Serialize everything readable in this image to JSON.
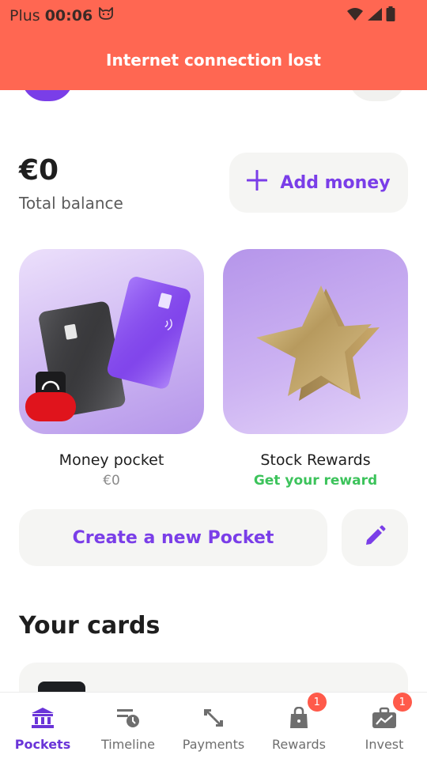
{
  "status_bar": {
    "carrier": "Plus",
    "time": "00:06"
  },
  "banner": {
    "message": "Internet connection lost",
    "color": "#ff6752"
  },
  "balance": {
    "amount": "€0",
    "label": "Total balance"
  },
  "actions": {
    "add_money_label": "Add money",
    "create_pocket_label": "Create a new Pocket"
  },
  "pockets": [
    {
      "name": "Money pocket",
      "subtitle": "€0",
      "subtitle_color": "#8a8a8a"
    },
    {
      "name": "Stock Rewards",
      "subtitle": "Get your reward",
      "subtitle_color": "#3cc35b"
    }
  ],
  "cards_section": {
    "title": "Your cards"
  },
  "bottom_nav": {
    "items": [
      {
        "label": "Pockets",
        "icon": "bank-icon",
        "active": true
      },
      {
        "label": "Timeline",
        "icon": "timeline-icon",
        "active": false
      },
      {
        "label": "Payments",
        "icon": "transfer-arrows-icon",
        "active": false
      },
      {
        "label": "Rewards",
        "icon": "shopping-bag-icon",
        "active": false,
        "badge": "1"
      },
      {
        "label": "Invest",
        "icon": "briefcase-chart-icon",
        "active": false,
        "badge": "1"
      }
    ]
  },
  "colors": {
    "accent": "#7a3ee8",
    "nav_active": "#6a34d8",
    "badge": "#ff5a4a",
    "button_bg": "#f5f5f3"
  }
}
